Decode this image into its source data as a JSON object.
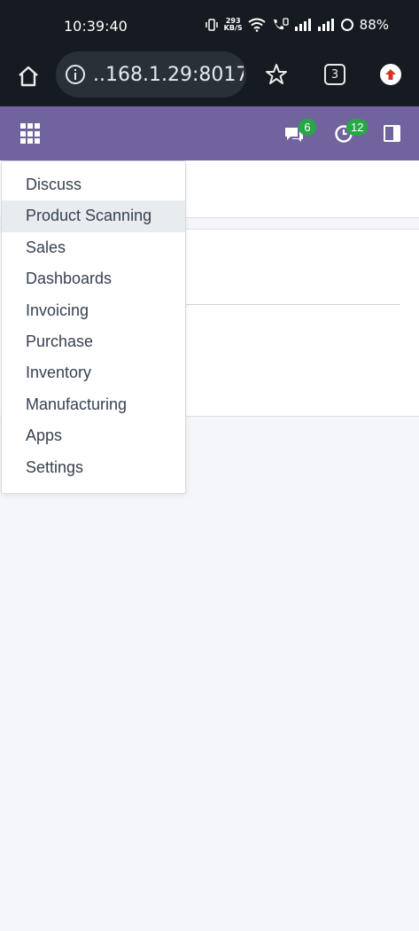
{
  "status_bar": {
    "time": "10:39:40",
    "net_speed_value": "293",
    "net_speed_unit": "KB/S",
    "battery": "88%"
  },
  "browser": {
    "url": "..168.1.29:8017",
    "tab_count": "3"
  },
  "navbar": {
    "messages_badge": "6",
    "activities_badge": "12"
  },
  "menu": {
    "items": [
      {
        "label": "Discuss"
      },
      {
        "label": "Product Scanning"
      },
      {
        "label": "Sales"
      },
      {
        "label": "Dashboards"
      },
      {
        "label": "Invoicing"
      },
      {
        "label": "Purchase"
      },
      {
        "label": "Inventory"
      },
      {
        "label": "Manufacturing"
      },
      {
        "label": "Apps"
      },
      {
        "label": "Settings"
      }
    ],
    "active_item": "Product Scanning"
  },
  "colors": {
    "navbar": "#71639e",
    "badge": "#28a745",
    "browser_chrome": "#161b21"
  }
}
